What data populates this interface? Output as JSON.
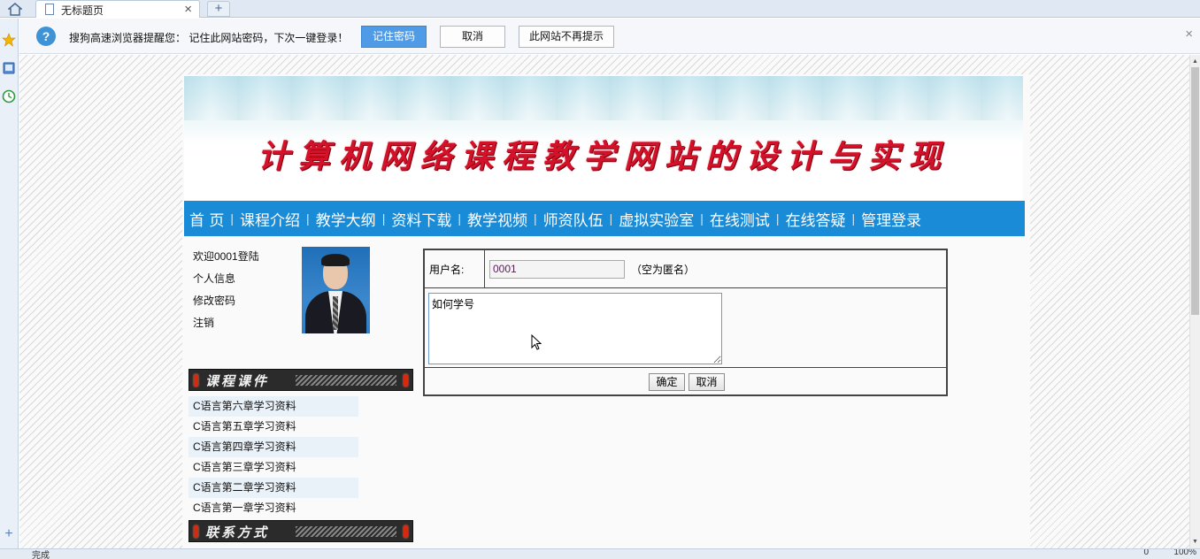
{
  "browser": {
    "tab_title": "无标题页",
    "new_tab_glyph": "+",
    "close_glyph": "×"
  },
  "notification": {
    "message": "搜狗高速浏览器提醒您： 记住此网站密码，下次一键登录！",
    "remember_label": "记住密码",
    "cancel_label": "取消",
    "never_label": "此网站不再提示"
  },
  "site": {
    "banner_title": "计算机网络课程教学网站的设计与实现",
    "nav": [
      {
        "label": "首  页"
      },
      {
        "label": "课程介绍"
      },
      {
        "label": "教学大纲"
      },
      {
        "label": "资料下载"
      },
      {
        "label": "教学视频"
      },
      {
        "label": "师资队伍"
      },
      {
        "label": "虚拟实验室"
      },
      {
        "label": "在线测试"
      },
      {
        "label": "在线答疑"
      },
      {
        "label": "管理登录"
      }
    ],
    "nav_separator": "|",
    "user": {
      "welcome": "欢迎0001登陆",
      "profile": "个人信息",
      "change_password": "修改密码",
      "logout": "注销"
    },
    "courseware_title": "课程课件",
    "courses": [
      "C语言第六章学习资料",
      "C语言第五章学习资料",
      "C语言第四章学习资料",
      "C语言第三章学习资料",
      "C语言第二章学习资料",
      "C语言第一章学习资料"
    ],
    "contact_title": "联系方式",
    "form": {
      "username_label": "用户名:",
      "username_value": "0001",
      "username_hint": "（空为匿名）",
      "question_value": "如何学号",
      "submit_label": "确定",
      "cancel_label": "取消"
    }
  },
  "status": {
    "text": "完成",
    "count": "0",
    "zoom": "100%"
  },
  "colors": {
    "nav_bg": "#1a8bd6",
    "banner_title": "#d3122a",
    "primary_button": "#4f9be5"
  }
}
